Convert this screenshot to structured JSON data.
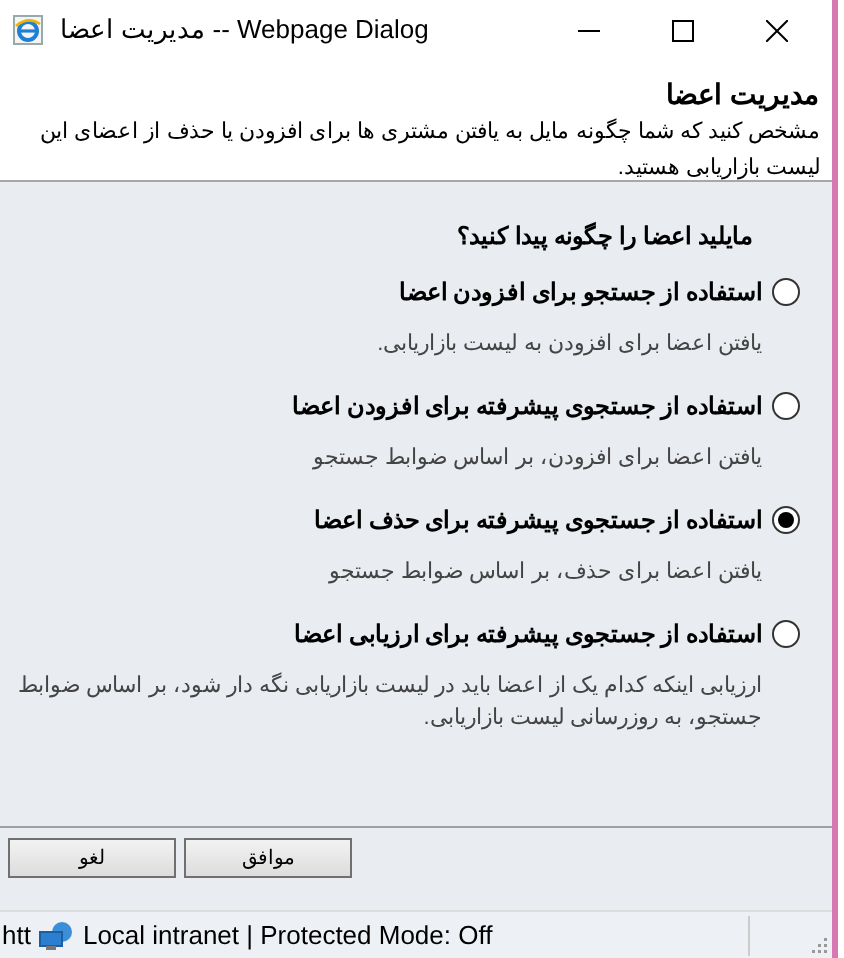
{
  "window": {
    "title": "مدیریت اعضا -- Webpage Dialog"
  },
  "header": {
    "title": "مدیریت اعضا",
    "description": "مشخص کنید که شما چگونه مایل به یافتن مشتری ها برای افزودن یا حذف از اعضای این لیست بازاریابی هستید."
  },
  "question": "مایلید اعضا را چگونه پیدا کنید؟",
  "options": [
    {
      "label": "استفاده از جستجو برای افزودن اعضا",
      "description": "یافتن اعضا برای افزودن به لیست بازاریابی.",
      "selected": false
    },
    {
      "label": "استفاده از جستجوی پیشرفته برای افزودن اعضا",
      "description": "یافتن اعضا برای افزودن، بر اساس ضوابط جستجو",
      "selected": false
    },
    {
      "label": "استفاده از جستجوی پیشرفته برای حذف اعضا",
      "description": "یافتن اعضا برای حذف، بر اساس ضوابط جستجو",
      "selected": true
    },
    {
      "label": "استفاده از جستجوی پیشرفته برای ارزیابی اعضا",
      "description": "ارزیابی اینکه کدام یک از اعضا باید در لیست بازاریابی نگه دار شود، بر اساس ضوابط جستجو، به روزرسانی لیست بازاریابی.",
      "selected": false
    }
  ],
  "buttons": [
    "موافق",
    "لغو"
  ],
  "status_bar": {
    "url": "htt",
    "zone": "Local intranet | Protected Mode: Off"
  }
}
